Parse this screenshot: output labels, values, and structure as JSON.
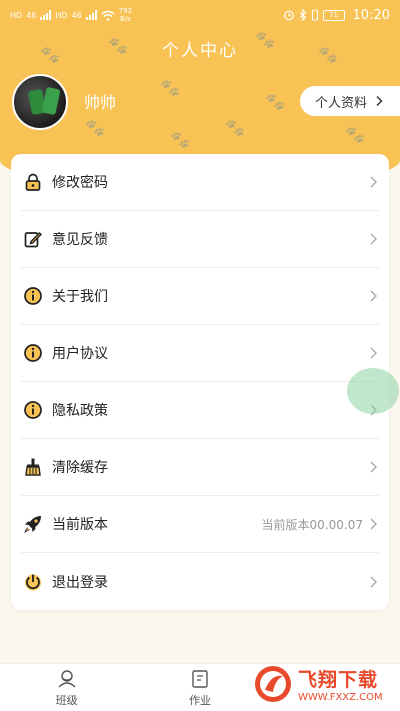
{
  "status_bar": {
    "sim1": "HD",
    "sim2": "HD",
    "network1": "46",
    "network2": "46",
    "speed_value": "792",
    "speed_unit": "B/s",
    "battery": "71",
    "time": "10:20"
  },
  "header": {
    "title": "个人中心"
  },
  "profile": {
    "username": "帅帅",
    "profile_button_label": "个人资料",
    "avatar_icon": "avatar-image"
  },
  "menu": {
    "items": [
      {
        "label": "修改密码",
        "icon": "lock-icon"
      },
      {
        "label": "意见反馈",
        "icon": "edit-icon"
      },
      {
        "label": "关于我们",
        "icon": "info-icon"
      },
      {
        "label": "用户协议",
        "icon": "info-icon"
      },
      {
        "label": "隐私政策",
        "icon": "info-icon"
      },
      {
        "label": "清除缓存",
        "icon": "broom-icon"
      },
      {
        "label": "当前版本",
        "icon": "rocket-icon",
        "value": "当前版本00.00.07"
      },
      {
        "label": "退出登录",
        "icon": "power-icon"
      }
    ]
  },
  "tab_bar": {
    "tabs": [
      {
        "label": "班级",
        "icon": "class-icon"
      },
      {
        "label": "作业",
        "icon": "homework-icon"
      }
    ]
  },
  "watermark": {
    "text": "飞翔下载",
    "url": "WWW.FXXZ.COM"
  },
  "colors": {
    "header_bg": "#f8c255",
    "page_bg": "#fbf6ee",
    "watermark_red": "#e84a2b"
  }
}
